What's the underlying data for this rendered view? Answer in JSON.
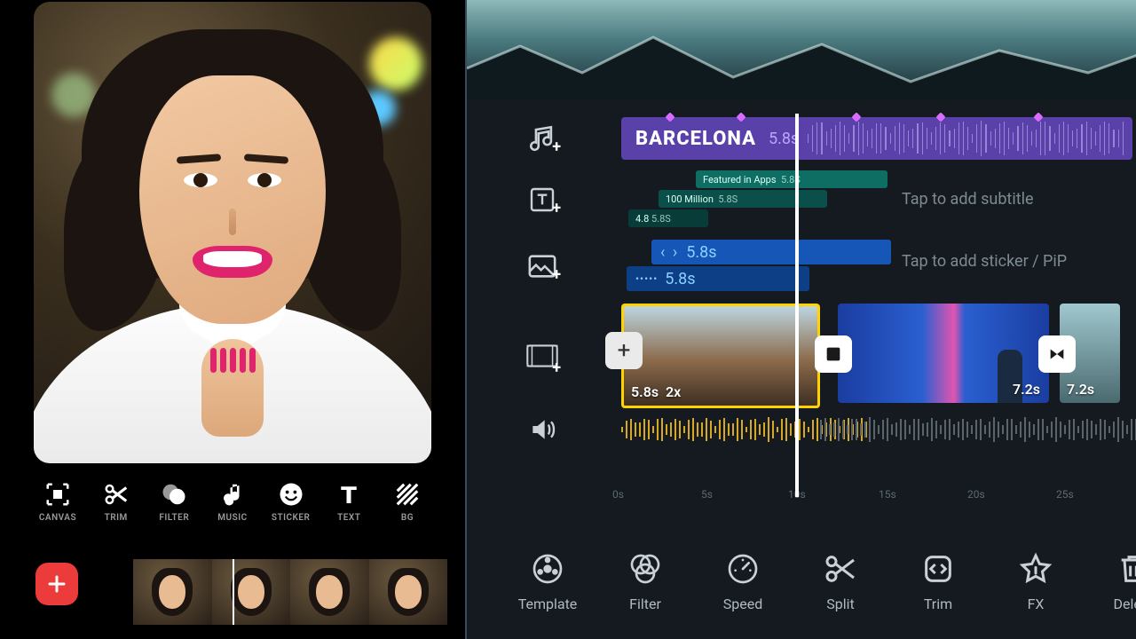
{
  "colors": {
    "accent_red": "#eb3b3b",
    "accent_yellow": "#ffd200",
    "music": "#5941a9",
    "teal": "#0e6e63",
    "blue": "#1656b6"
  },
  "left_tools": [
    {
      "id": "canvas",
      "label": "CANVAS"
    },
    {
      "id": "trim",
      "label": "TRIM"
    },
    {
      "id": "filter",
      "label": "FILTER"
    },
    {
      "id": "music",
      "label": "MUSIC"
    },
    {
      "id": "sticker",
      "label": "STICKER"
    },
    {
      "id": "text",
      "label": "TEXT"
    },
    {
      "id": "bg",
      "label": "BG"
    }
  ],
  "add_button": "+",
  "timeline": {
    "music": {
      "title": "BARCELONA",
      "duration": "5.8s"
    },
    "text_clips": [
      {
        "label": "Featured in Apps",
        "dur": "5.8S"
      },
      {
        "label": "100 Million",
        "dur": "5.8S"
      },
      {
        "label": "4.8",
        "dur": "5.8S"
      }
    ],
    "subtitle_hint": "Tap to add subtitle",
    "pip_clips": [
      {
        "label": "5.8s",
        "prefix": "‹ ›"
      },
      {
        "label": "5.8s",
        "prefix": "•••••"
      }
    ],
    "pip_hint": "Tap to add sticker / PiP",
    "video_clips": [
      {
        "dur": "5.8s",
        "speed": "2x"
      },
      {
        "dur": "7.2s"
      },
      {
        "dur": "7.2s"
      }
    ],
    "insert": "+",
    "ruler": [
      "0s",
      "5s",
      "10s",
      "15s",
      "20s",
      "25s"
    ]
  },
  "bottom_tools": [
    {
      "id": "template",
      "label": "Template"
    },
    {
      "id": "filter",
      "label": "Filter"
    },
    {
      "id": "speed",
      "label": "Speed"
    },
    {
      "id": "split",
      "label": "Split"
    },
    {
      "id": "trim",
      "label": "Trim"
    },
    {
      "id": "fx",
      "label": "FX"
    },
    {
      "id": "delete",
      "label": "Delete"
    }
  ]
}
